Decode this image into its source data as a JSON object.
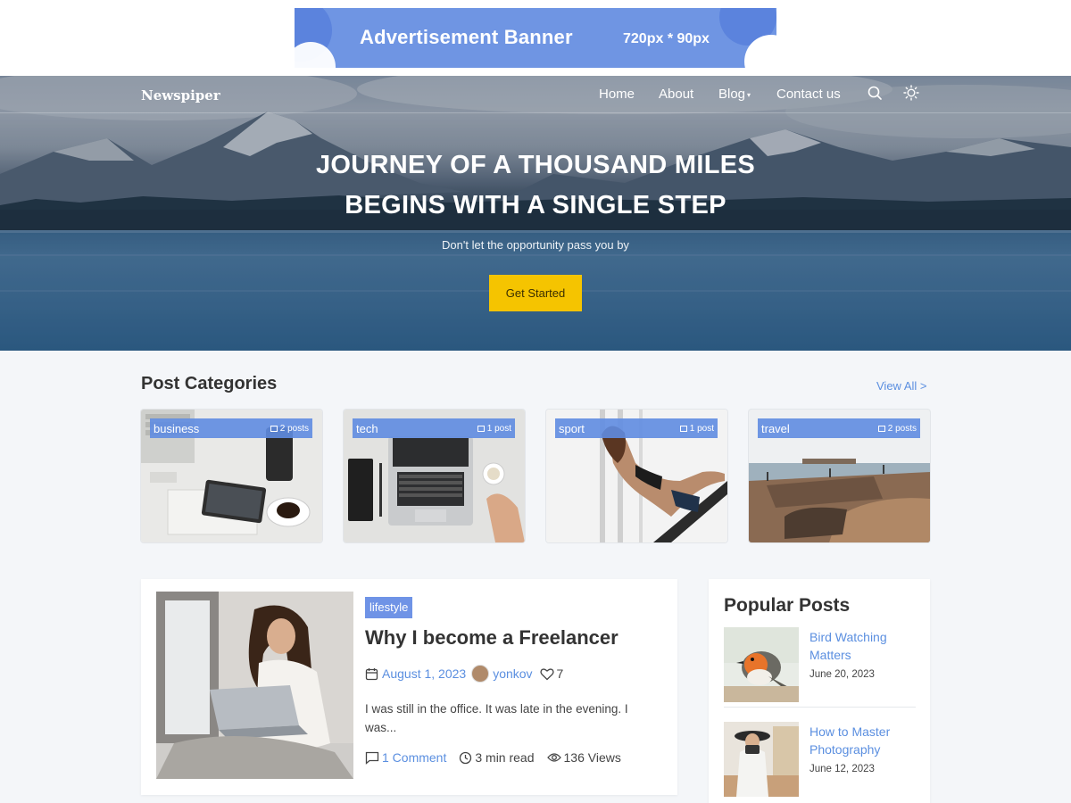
{
  "ad": {
    "text": "Advertisement Banner",
    "size": "720px * 90px"
  },
  "nav": {
    "logo": "Newspiper",
    "items": [
      {
        "label": "Home"
      },
      {
        "label": "About"
      },
      {
        "label": "Blog"
      },
      {
        "label": "Contact us"
      }
    ],
    "blog_has_dropdown": true,
    "icons": [
      "search-icon",
      "sun-icon"
    ]
  },
  "hero": {
    "title_line1": "JOURNEY OF A THOUSAND MILES",
    "title_line2": "BEGINS WITH A SINGLE STEP",
    "subtitle": "Don't let the opportunity pass you by",
    "cta": "Get Started"
  },
  "categories": {
    "title": "Post Categories",
    "view_all": "View All >",
    "items": [
      {
        "name": "business",
        "count": "2 posts"
      },
      {
        "name": "tech",
        "count": "1 post"
      },
      {
        "name": "sport",
        "count": "1 post"
      },
      {
        "name": "travel",
        "count": "2 posts"
      }
    ]
  },
  "post": {
    "tag": "lifestyle",
    "title": "Why I become a Freelancer",
    "date": "August 1, 2023",
    "author": "yonkov",
    "likes": "7",
    "excerpt": "I was still in the office. It was late in the evening. I was...",
    "comments": "1 Comment",
    "read_time": "3 min read",
    "views": "136 Views"
  },
  "popular": {
    "title": "Popular Posts",
    "items": [
      {
        "title": "Bird Watching Matters",
        "date": "June 20, 2023"
      },
      {
        "title": "How to Master Photography",
        "date": "June 12, 2023"
      }
    ]
  },
  "colors": {
    "accent": "#5b8fe0",
    "tag_bg": "#6f93e6",
    "cta": "#f5c400",
    "ad_bg": "#6f95e3",
    "page_bg": "#f4f6f9"
  }
}
